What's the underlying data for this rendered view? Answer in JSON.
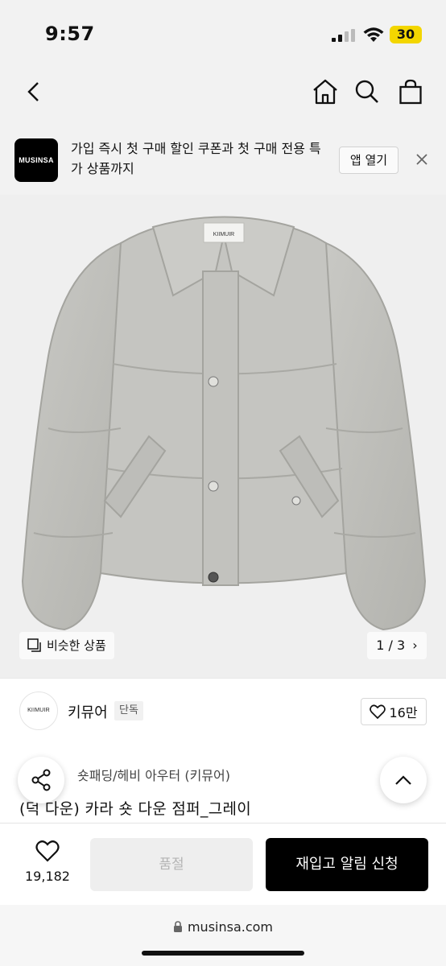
{
  "status_bar": {
    "time": "9:57",
    "battery": "30",
    "battery_color": "#f3d600"
  },
  "nav": {
    "icons": [
      "back-icon",
      "home-icon",
      "search-icon",
      "shopping-bag-icon"
    ]
  },
  "app_banner": {
    "logo_text": "MUSINSA",
    "message": "가입 즉시 첫 구매 할인 쿠폰과 첫 구매 전용 특가 상품까지",
    "open_app_label": "앱 열기"
  },
  "product_image": {
    "label_text": "KIIMUIR",
    "similar_label": "비슷한 상품",
    "pager": "1 / 3"
  },
  "brand": {
    "logo_text": "KIIMUIR",
    "name": "키뮤어",
    "badge": "단독",
    "likes": "16만"
  },
  "product": {
    "category": "숏패딩/헤비 아우터 (키뮤어)",
    "title": "(덕 다운) 카라 숏 다운 점퍼_그레이"
  },
  "purchase_bar": {
    "wish_count": "19,182",
    "soldout_label": "품절",
    "restock_label": "재입고 알림 신청"
  },
  "browser": {
    "url": "musinsa.com"
  }
}
